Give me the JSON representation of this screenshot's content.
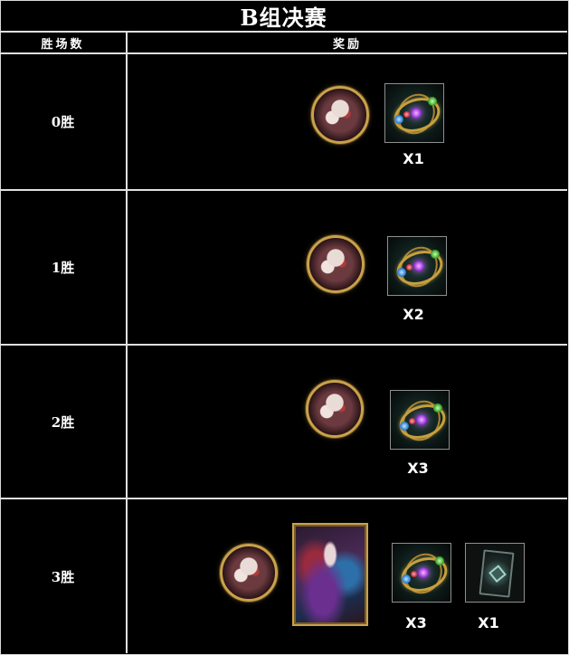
{
  "title": "B组决赛",
  "headers": {
    "wins": "胜场数",
    "rewards": "奖励"
  },
  "rows": [
    {
      "label": "0胜",
      "qty_orb": "X1"
    },
    {
      "label": "1胜",
      "qty_orb": "X2"
    },
    {
      "label": "2胜",
      "qty_orb": "X3"
    },
    {
      "label": "3胜",
      "qty_orb": "X3",
      "qty_card": "X1"
    }
  ]
}
